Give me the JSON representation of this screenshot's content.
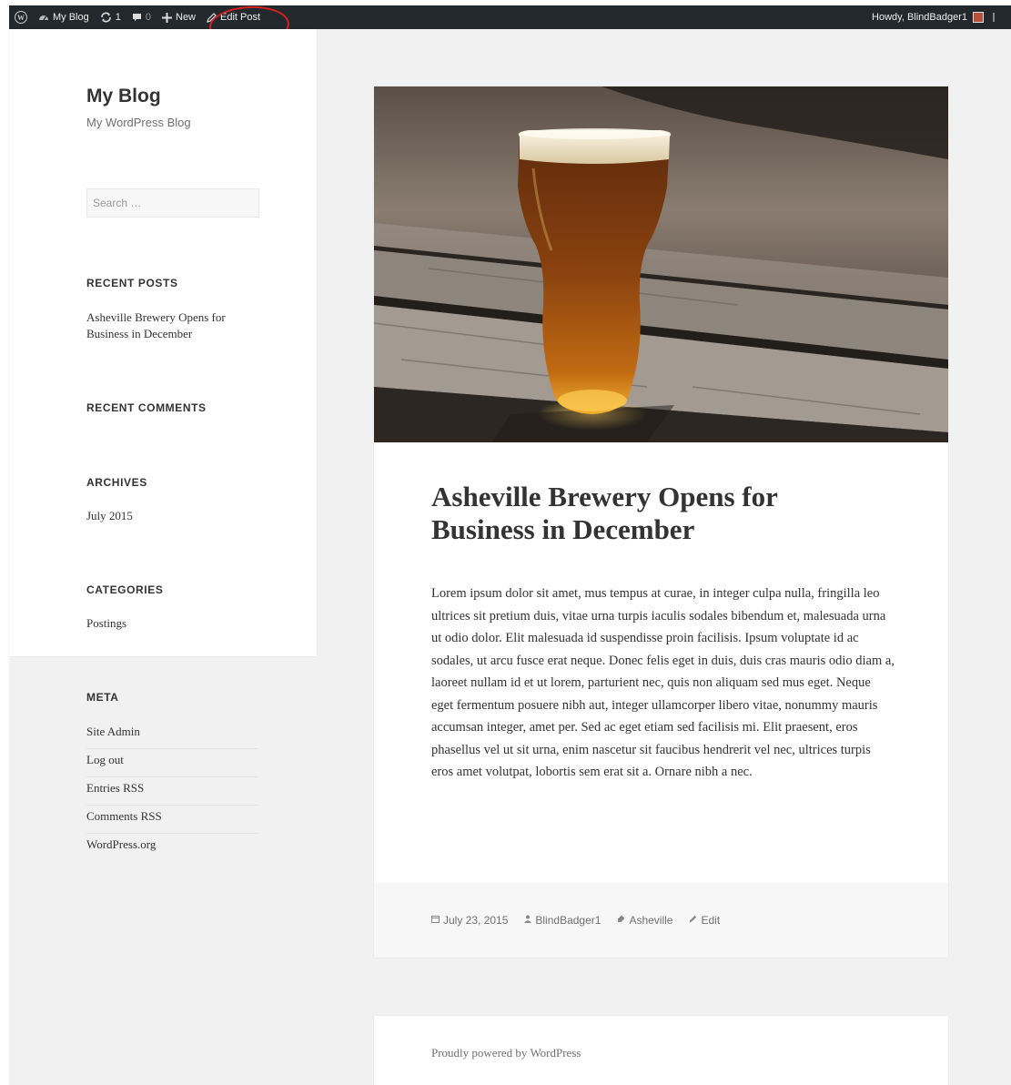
{
  "adminbar": {
    "wp_logo_icon": "wordpress-logo-icon",
    "site_icon": "dashboard-icon",
    "site_name": "My Blog",
    "updates_icon": "updates-icon",
    "updates_count": "1",
    "comments_icon": "comment-icon",
    "comments_count": "0",
    "new_icon": "plus-icon",
    "new_label": "New",
    "edit_icon": "pencil-icon",
    "edit_label": "Edit Post",
    "howdy": "Howdy, BlindBadger1",
    "annotation_color": "#d32020"
  },
  "sidebar": {
    "site_title": "My Blog",
    "site_description": "My WordPress Blog",
    "search_placeholder": "Search …",
    "recent_posts_title": "RECENT POSTS",
    "recent_posts": [
      "Asheville Brewery Opens for Business in December"
    ],
    "recent_comments_title": "RECENT COMMENTS",
    "archives_title": "ARCHIVES",
    "archives": [
      "July 2015"
    ],
    "categories_title": "CATEGORIES",
    "categories": [
      "Postings"
    ],
    "meta_title": "META",
    "meta": [
      "Site Admin",
      "Log out",
      "Entries RSS",
      "Comments RSS",
      "WordPress.org"
    ]
  },
  "post": {
    "image_subject": "glass-of-beer-on-wooden-table",
    "title": "Asheville Brewery Opens for Business in December",
    "body": "Lorem ipsum dolor sit amet, mus tempus at curae, in integer culpa nulla, fringilla leo ultrices sit pretium duis, vitae urna turpis iaculis sodales bibendum et, malesuada urna ut odio dolor. Elit malesuada id sus­pendisse proin facilisis. Ipsum voluptate id ac sodales, ut arcu fusce erat neque. Donec felis eget in duis, duis cras mauris odio diam a, laoreet nul­lam id et ut lorem, parturient nec, quis non aliquam sed mus eget. Neque eget fermentum posuere nibh aut, integer ullamcorper libero vitae, non­ummy mauris accumsan integer, amet per. Sed ac eget etiam sed facilisis mi. Elit praesent, eros phasellus vel ut sit urna, enim nascetur sit fau­cibus hendrerit vel nec, ultrices turpis eros amet volutpat, lobortis sem erat sit a. Ornare nibh a nec.",
    "footer": {
      "date_icon": "calendar-icon",
      "date": "July 23, 2015",
      "author_icon": "user-icon",
      "author": "BlindBadger1",
      "tag_icon": "tag-icon",
      "tag": "Asheville",
      "edit_icon": "pencil-icon",
      "edit": "Edit"
    }
  },
  "site_footer": {
    "text": "Proudly powered by WordPress"
  }
}
